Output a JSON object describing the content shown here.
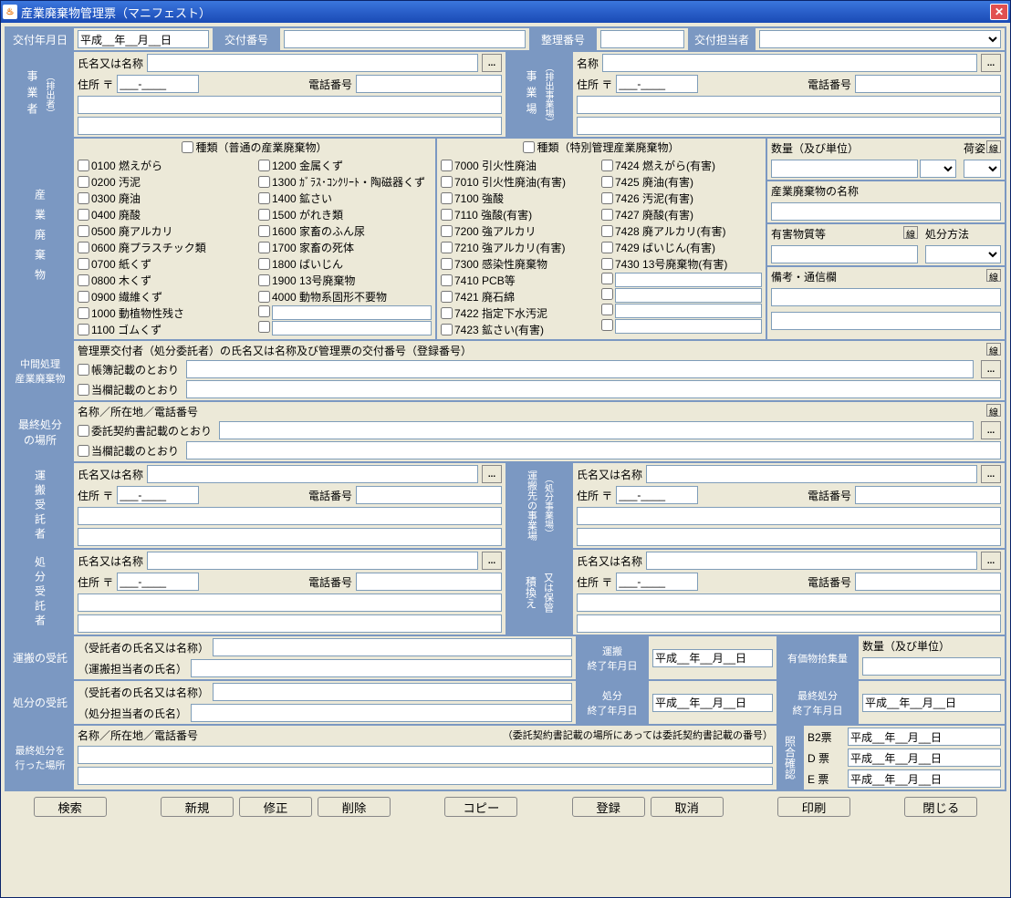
{
  "window_title": "産業廃棄物管理票（マニフェスト）",
  "header": {
    "issue_date_label": "交付年月日",
    "issue_date_value": "平成__年__月__日",
    "issue_number_label": "交付番号",
    "org_number_label": "整理番号",
    "issuer_label": "交付担当者"
  },
  "emitter": {
    "section_label": "事　業　者",
    "sub_label": "（排出者）",
    "name_label": "氏名又は名称",
    "addr_label": "住所 〒",
    "postal_sep": "___-____",
    "tel_label": "電話番号"
  },
  "site": {
    "section_label": "事　業　場",
    "sub_label": "（排出事業場）",
    "name_label": "名称",
    "addr_label": "住所 〒",
    "postal_sep": "___-____",
    "tel_label": "電話番号"
  },
  "waste": {
    "section_label": "産　業　廃　棄　物",
    "normal_header": "種類（普通の産業廃棄物）",
    "special_header": "種類（特別管理産業廃棄物）",
    "normal_col1": [
      "0100 燃えがら",
      "0200 汚泥",
      "0300 廃油",
      "0400 廃酸",
      "0500 廃アルカリ",
      "0600 廃プラスチック類",
      "0700 紙くず",
      "0800 木くず",
      "0900 繊維くず",
      "1000 動植物性残さ",
      "1100 ゴムくず"
    ],
    "normal_col2": [
      "1200 金属くず",
      "1300 ｶﾞﾗｽ･ｺﾝｸﾘｰﾄ・陶磁器くず",
      "1400 鉱さい",
      "1500 がれき類",
      "1600 家畜のふん尿",
      "1700 家畜の死体",
      "1800 ばいじん",
      "1900 13号廃棄物",
      "4000 動物系固形不要物"
    ],
    "special_col1": [
      "7000 引火性廃油",
      "7010 引火性廃油(有害)",
      "7100 強酸",
      "7110 強酸(有害)",
      "7200 強アルカリ",
      "7210 強アルカリ(有害)",
      "7300 感染性廃棄物",
      "7410 PCB等",
      "7421 廃石綿",
      "7422 指定下水汚泥",
      "7423 鉱さい(有害)"
    ],
    "special_col2": [
      "7424 燃えがら(有害)",
      "7425 廃油(有害)",
      "7426 汚泥(有害)",
      "7427 廃酸(有害)",
      "7428 廃アルカリ(有害)",
      "7429 ばいじん(有害)",
      "7430 13号廃棄物(有害)"
    ],
    "qty_label": "数量（及び単位）",
    "pack_label": "荷姿",
    "waste_name_label": "産業廃棄物の名称",
    "hazmat_label": "有害物質等",
    "disposal_method_label": "処分方法",
    "notes_label": "備考・通信欄",
    "line_btn": "線"
  },
  "midproc": {
    "section_label": "中間処理\n産業廃棄物",
    "header_text": "管理票交付者（処分委託者）の氏名又は名称及び管理票の交付番号（登録番号）",
    "chk1": "帳簿記載のとおり",
    "chk2": "当欄記載のとおり"
  },
  "final_place": {
    "section_label": "最終処分\nの場所",
    "header_text": "名称／所在地／電話番号",
    "chk1": "委託契約書記載のとおり",
    "chk2": "当欄記載のとおり"
  },
  "transporter": {
    "section_label": "運搬受託者",
    "name_label": "氏名又は名称",
    "addr_label": "住所 〒",
    "postal_sep": "___-____",
    "tel_label": "電話番号"
  },
  "dest": {
    "section_label": "運搬先の事業場",
    "sub_label": "（処分事業場）",
    "name_label": "氏名又は名称",
    "addr_label": "住所 〒",
    "postal_sep": "___-____",
    "tel_label": "電話番号"
  },
  "disposer": {
    "section_label": "処分受託者",
    "name_label": "氏名又は名称",
    "addr_label": "住所 〒",
    "postal_sep": "___-____",
    "tel_label": "電話番号"
  },
  "transfer": {
    "section_label": "積換え",
    "sub_label": "又は保管",
    "name_label": "氏名又は名称",
    "addr_label": "住所 〒",
    "postal_sep": "___-____",
    "tel_label": "電話番号"
  },
  "transport_accept": {
    "section_label": "運搬の受託",
    "name_label": "（受託者の氏名又は名称）",
    "person_label": "（運搬担当者の氏名）",
    "end_label": "運搬\n終了年月日",
    "end_value": "平成__年__月__日",
    "valuable_label": "有価物拾集量",
    "qty_label": "数量（及び単位）"
  },
  "disposal_accept": {
    "section_label": "処分の受託",
    "name_label": "（受託者の氏名又は名称）",
    "person_label": "（処分担当者の氏名）",
    "end_label": "処分\n終了年月日",
    "end_value": "平成__年__月__日",
    "final_end_label": "最終処分\n終了年月日",
    "final_end_value": "平成__年__月__日"
  },
  "final_done": {
    "section_label": "最終処分を\n行った場所",
    "header": "名称／所在地／電話番号",
    "note": "（委託契約書記載の場所にあっては委託契約書記載の番号）"
  },
  "verify": {
    "section_label": "照合確認",
    "b2_label": "B2票",
    "d_label": "D 票",
    "e_label": "E 票",
    "date_value": "平成__年__月__日"
  },
  "buttons": {
    "search": "検索",
    "new": "新規",
    "edit": "修正",
    "delete": "削除",
    "copy": "コピー",
    "register": "登録",
    "cancel": "取消",
    "print": "印刷",
    "close": "閉じる"
  }
}
